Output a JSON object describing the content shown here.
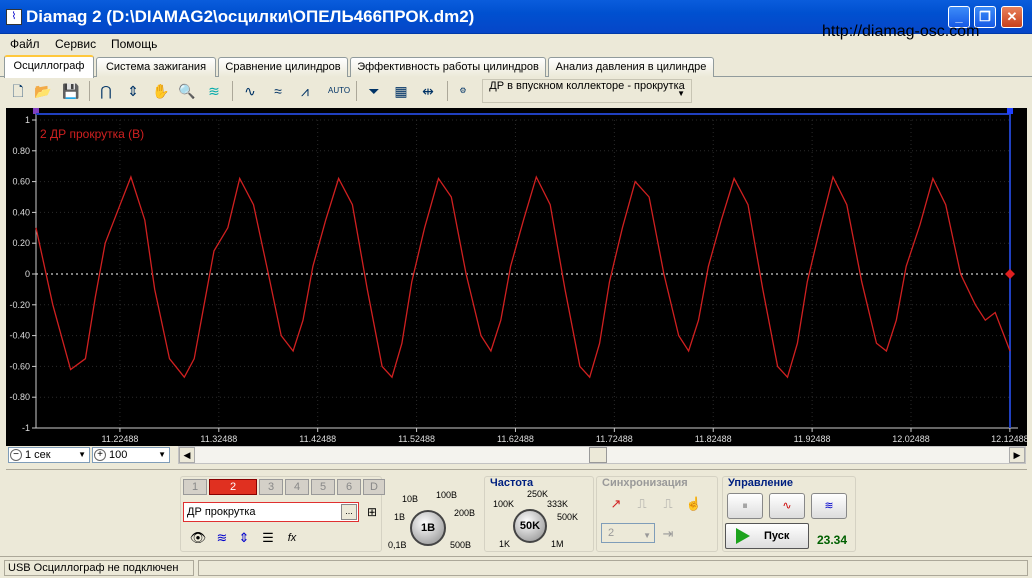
{
  "window": {
    "title": "Diamag 2 (D:\\DIAMAG2\\осцилки\\ОПЕЛЬ466ПРОК.dm2)",
    "icon": "diamag-app-icon",
    "minimize": "minimize-icon",
    "maximize": "maximize-icon",
    "close": "close-icon"
  },
  "site_url": "http://diamag-osc.com",
  "menu": {
    "items": [
      "Файл",
      "Сервис",
      "Помощь"
    ]
  },
  "tabs": [
    {
      "label": "Осциллограф",
      "active": true
    },
    {
      "label": "Система зажигания"
    },
    {
      "label": "Сравнение цилиндров"
    },
    {
      "label": "Эффективность работы цилиндров"
    },
    {
      "label": "Анализ давления в цилиндре"
    }
  ],
  "toolbar": {
    "icons": [
      "new-file-icon",
      "open-folder-icon",
      "save-icon",
      "cursor-markers-icon",
      "measure-icon",
      "hand-pan-icon",
      "zoom-icon",
      "ignition-icon",
      "wave-compare-icon",
      "wave-filter-icon",
      "wave-peak-icon",
      "auto-scale-icon",
      "channel-filter-icon",
      "table-icon",
      "cursor-line-icon",
      "auto-settings-icon"
    ],
    "source_select": "ДР в впускном коллекторе - прокрутка"
  },
  "scope": {
    "channel_label": "2 ДР прокрутка (В)",
    "y_ticks": [
      "1",
      "0.80",
      "0.60",
      "0.40",
      "0.20",
      "0",
      "-0.20",
      "-0.40",
      "-0.60",
      "-0.80",
      "-1"
    ],
    "x_ticks": [
      "11.22488",
      "11.32488",
      "11.42488",
      "11.52488",
      "11.62488",
      "11.72488",
      "11.82488",
      "11.92488",
      "12.02488",
      "12.12488"
    ],
    "marker_left": "1",
    "marker_right": "2",
    "trace_color": "#d02020",
    "background": "#000000"
  },
  "chart_data": {
    "type": "line",
    "title": "",
    "series": [
      {
        "name": "2 ДР прокрутка (В)",
        "color": "#d02020",
        "x": [
          11.14,
          11.157,
          11.175,
          11.19,
          11.2,
          11.21,
          11.225,
          11.236,
          11.25,
          11.26,
          11.275,
          11.29,
          11.3,
          11.31,
          11.32,
          11.334,
          11.346,
          11.36,
          11.375,
          11.388,
          11.4,
          11.41,
          11.42,
          11.433,
          11.446,
          11.46,
          11.475,
          11.49,
          11.5,
          11.51,
          11.52,
          11.533,
          11.547,
          11.56,
          11.575,
          11.59,
          11.6,
          11.61,
          11.62,
          11.633,
          11.646,
          11.66,
          11.675,
          11.69,
          11.7,
          11.71,
          11.72,
          11.733,
          11.746,
          11.76,
          11.775,
          11.79,
          11.8,
          11.81,
          11.82,
          11.833,
          11.846,
          11.86,
          11.875,
          11.89,
          11.9,
          11.91,
          11.92,
          11.933,
          11.946,
          11.96,
          11.975,
          11.99,
          12.0,
          12.01,
          12.02,
          12.034,
          12.047,
          12.06,
          12.075,
          12.09,
          12.1,
          12.11,
          12.125
        ],
        "y": [
          0.3,
          -0.2,
          -0.62,
          -0.55,
          -0.15,
          0.2,
          0.45,
          0.63,
          0.35,
          -0.1,
          -0.55,
          -0.67,
          -0.55,
          -0.2,
          0.15,
          0.3,
          0.62,
          0.45,
          0.0,
          -0.4,
          -0.5,
          -0.3,
          0.05,
          0.35,
          0.62,
          0.45,
          -0.1,
          -0.6,
          -0.67,
          -0.45,
          -0.05,
          0.3,
          0.62,
          0.5,
          0.0,
          -0.4,
          -0.5,
          -0.3,
          0.05,
          0.35,
          0.63,
          0.45,
          -0.1,
          -0.6,
          -0.67,
          -0.45,
          -0.05,
          0.3,
          0.6,
          0.5,
          0.0,
          -0.4,
          -0.5,
          -0.3,
          0.05,
          0.35,
          0.62,
          0.45,
          -0.1,
          -0.6,
          -0.67,
          -0.45,
          -0.05,
          0.3,
          0.63,
          0.45,
          -0.05,
          -0.45,
          -0.5,
          -0.3,
          0.05,
          0.32,
          0.62,
          0.45,
          0.0,
          -0.2,
          -0.3,
          -0.25,
          -0.5
        ]
      }
    ],
    "xlim": [
      11.14,
      12.125
    ],
    "ylim": [
      -1,
      1
    ],
    "y_ticks": [
      "1",
      "0.80",
      "0.60",
      "0.40",
      "0.20",
      "0",
      "-0.20",
      "-0.40",
      "-0.60",
      "-0.80",
      "-1"
    ],
    "x_ticks": [
      "11.22488",
      "11.32488",
      "11.42488",
      "11.52488",
      "11.62488",
      "11.72488",
      "11.82488",
      "11.92488",
      "12.02488",
      "12.12488"
    ],
    "grid": true,
    "zero_line": "dashed"
  },
  "timebar": {
    "timebase": "1 сек",
    "zoom": "100",
    "minus_icon": "minus-icon",
    "plus_icon": "plus-icon"
  },
  "channels": {
    "buttons": [
      "1",
      "2",
      "3",
      "4",
      "5",
      "6",
      "D"
    ],
    "active": "2",
    "signal": "ДР прокрутка",
    "signal_button": "...",
    "icons": [
      "eye-icon",
      "wave-invert-icon",
      "vertical-shift-icon",
      "hatch-icon",
      "function-icon"
    ]
  },
  "voltage_knob": {
    "value": "1В",
    "labels": [
      "10В",
      "100В",
      "1В",
      "200В",
      "0,1В",
      "500В"
    ]
  },
  "frequency": {
    "title": "Частота",
    "value": "50K",
    "labels": [
      "250K",
      "100K",
      "333K",
      "500K",
      "1K",
      "1M"
    ]
  },
  "sync": {
    "title": "Синхронизация",
    "channel": "2"
  },
  "control": {
    "title": "Управление",
    "run_label": "Пуск",
    "fps": "23.34",
    "pause_icon": "pause-icon",
    "sine_icon": "sine-wave-icon",
    "multi_icon": "multi-wave-icon"
  },
  "status": {
    "text": "USB Осциллограф не подключен"
  }
}
